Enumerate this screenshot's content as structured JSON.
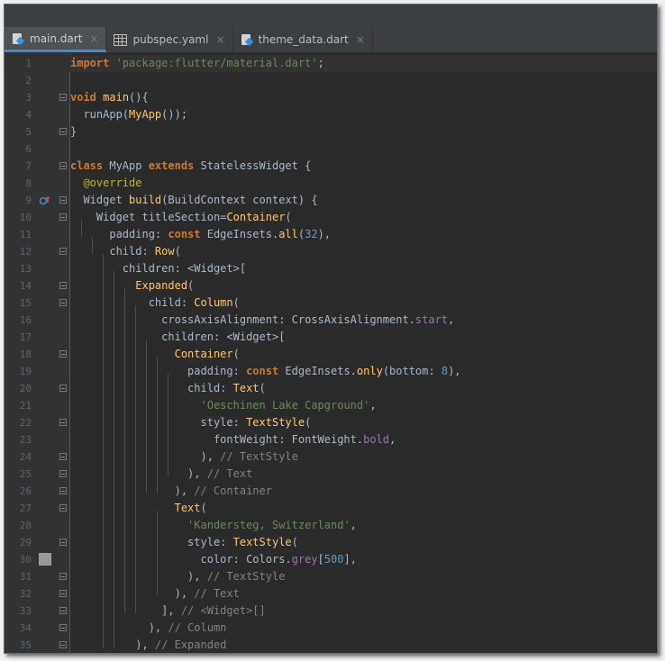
{
  "tabs": [
    {
      "label": "main.dart",
      "icon": "dart-file-icon",
      "active": true
    },
    {
      "label": "pubspec.yaml",
      "icon": "table-file-icon",
      "active": false
    },
    {
      "label": "theme_data.dart",
      "icon": "dart-file-icon",
      "active": false
    }
  ],
  "close_glyph": "×",
  "lines": [
    {
      "n": "1",
      "tokens": [
        [
          "kw",
          "import"
        ],
        [
          "plain",
          " "
        ],
        [
          "str",
          "'package:flutter/material.dart'"
        ],
        [
          "plain",
          ";"
        ]
      ]
    },
    {
      "n": "2",
      "tokens": []
    },
    {
      "n": "3",
      "tokens": [
        [
          "kw",
          "void"
        ],
        [
          "plain",
          " "
        ],
        [
          "fn",
          "main"
        ],
        [
          "plain",
          "(){"
        ]
      ]
    },
    {
      "n": "4",
      "tokens": [
        [
          "plain",
          "  runApp("
        ],
        [
          "cls",
          "MyApp"
        ],
        [
          "plain",
          "());"
        ]
      ]
    },
    {
      "n": "5",
      "tokens": [
        [
          "plain",
          "}"
        ]
      ]
    },
    {
      "n": "6",
      "tokens": []
    },
    {
      "n": "7",
      "tokens": [
        [
          "kw",
          "class"
        ],
        [
          "plain",
          " MyApp "
        ],
        [
          "kw",
          "extends"
        ],
        [
          "plain",
          " StatelessWidget {"
        ]
      ]
    },
    {
      "n": "8",
      "tokens": [
        [
          "plain",
          "  "
        ],
        [
          "ann",
          "@override"
        ]
      ]
    },
    {
      "n": "9",
      "tokens": [
        [
          "plain",
          "  Widget "
        ],
        [
          "fn",
          "build"
        ],
        [
          "plain",
          "(BuildContext context) {"
        ]
      ]
    },
    {
      "n": "10",
      "tokens": [
        [
          "plain",
          "    Widget titleSection="
        ],
        [
          "cls",
          "Container"
        ],
        [
          "plain",
          "("
        ]
      ]
    },
    {
      "n": "11",
      "tokens": [
        [
          "plain",
          "      padding: "
        ],
        [
          "kw",
          "const"
        ],
        [
          "plain",
          " EdgeInsets."
        ],
        [
          "fn",
          "all"
        ],
        [
          "plain",
          "("
        ],
        [
          "num",
          "32"
        ],
        [
          "plain",
          "),"
        ]
      ]
    },
    {
      "n": "12",
      "tokens": [
        [
          "plain",
          "      child: "
        ],
        [
          "cls",
          "Row"
        ],
        [
          "plain",
          "("
        ]
      ]
    },
    {
      "n": "13",
      "tokens": [
        [
          "plain",
          "        children: <Widget>["
        ]
      ]
    },
    {
      "n": "14",
      "tokens": [
        [
          "plain",
          "          "
        ],
        [
          "cls",
          "Expanded"
        ],
        [
          "plain",
          "("
        ]
      ]
    },
    {
      "n": "15",
      "tokens": [
        [
          "plain",
          "            child: "
        ],
        [
          "cls",
          "Column"
        ],
        [
          "plain",
          "("
        ]
      ]
    },
    {
      "n": "16",
      "tokens": [
        [
          "plain",
          "              crossAxisAlignment: CrossAxisAlignment."
        ],
        [
          "prop",
          "start"
        ],
        [
          "plain",
          ","
        ]
      ]
    },
    {
      "n": "17",
      "tokens": [
        [
          "plain",
          "              children: <Widget>["
        ]
      ]
    },
    {
      "n": "18",
      "tokens": [
        [
          "plain",
          "                "
        ],
        [
          "cls",
          "Container"
        ],
        [
          "plain",
          "("
        ]
      ]
    },
    {
      "n": "19",
      "tokens": [
        [
          "plain",
          "                  padding: "
        ],
        [
          "kw",
          "const"
        ],
        [
          "plain",
          " EdgeInsets."
        ],
        [
          "fn",
          "only"
        ],
        [
          "plain",
          "(bottom: "
        ],
        [
          "num",
          "8"
        ],
        [
          "plain",
          "),"
        ]
      ]
    },
    {
      "n": "20",
      "tokens": [
        [
          "plain",
          "                  child: "
        ],
        [
          "cls",
          "Text"
        ],
        [
          "plain",
          "("
        ]
      ]
    },
    {
      "n": "21",
      "tokens": [
        [
          "plain",
          "                    "
        ],
        [
          "str",
          "'Oeschinen Lake Capground'"
        ],
        [
          "plain",
          ","
        ]
      ]
    },
    {
      "n": "22",
      "tokens": [
        [
          "plain",
          "                    style: "
        ],
        [
          "cls",
          "TextStyle"
        ],
        [
          "plain",
          "("
        ]
      ]
    },
    {
      "n": "23",
      "tokens": [
        [
          "plain",
          "                      fontWeight: FontWeight."
        ],
        [
          "prop",
          "bold"
        ],
        [
          "plain",
          ","
        ]
      ]
    },
    {
      "n": "24",
      "tokens": [
        [
          "plain",
          "                    ), "
        ],
        [
          "cmt",
          "// TextStyle"
        ]
      ]
    },
    {
      "n": "25",
      "tokens": [
        [
          "plain",
          "                  ), "
        ],
        [
          "cmt",
          "// Text"
        ]
      ]
    },
    {
      "n": "26",
      "tokens": [
        [
          "plain",
          "                ), "
        ],
        [
          "cmt",
          "// Container"
        ]
      ]
    },
    {
      "n": "27",
      "tokens": [
        [
          "plain",
          "                "
        ],
        [
          "cls",
          "Text"
        ],
        [
          "plain",
          "("
        ]
      ]
    },
    {
      "n": "28",
      "tokens": [
        [
          "plain",
          "                  "
        ],
        [
          "str",
          "'Kandersteg, Switzerland'"
        ],
        [
          "plain",
          ","
        ]
      ]
    },
    {
      "n": "29",
      "tokens": [
        [
          "plain",
          "                  style: "
        ],
        [
          "cls",
          "TextStyle"
        ],
        [
          "plain",
          "("
        ]
      ]
    },
    {
      "n": "30",
      "tokens": [
        [
          "plain",
          "                    color: Colors."
        ],
        [
          "prop",
          "grey"
        ],
        [
          "plain",
          "["
        ],
        [
          "num",
          "500"
        ],
        [
          "plain",
          "],"
        ]
      ]
    },
    {
      "n": "31",
      "tokens": [
        [
          "plain",
          "                  ), "
        ],
        [
          "cmt",
          "// TextStyle"
        ]
      ]
    },
    {
      "n": "32",
      "tokens": [
        [
          "plain",
          "                ), "
        ],
        [
          "cmt",
          "// Text"
        ]
      ]
    },
    {
      "n": "33",
      "tokens": [
        [
          "plain",
          "              ], "
        ],
        [
          "cmt",
          "// <Widget>[]"
        ]
      ]
    },
    {
      "n": "34",
      "tokens": [
        [
          "plain",
          "            ), "
        ],
        [
          "cmt",
          "// Column"
        ]
      ]
    },
    {
      "n": "35",
      "tokens": [
        [
          "plain",
          "          ), "
        ],
        [
          "cmt",
          "// Expanded"
        ]
      ]
    }
  ]
}
